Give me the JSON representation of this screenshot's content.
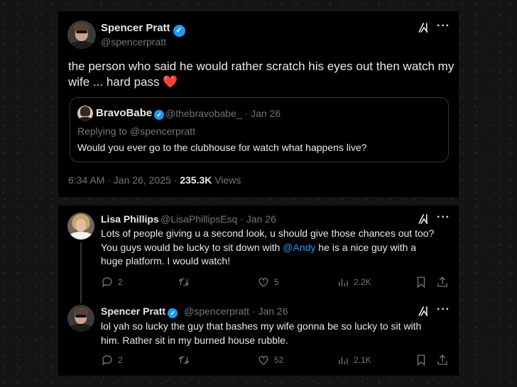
{
  "main_tweet": {
    "name": "Spencer Pratt",
    "handle": "@spencerpratt",
    "text_line1": "the person who said he would rather scratch his eyes out then watch my",
    "text_line2": "wife ... hard pass",
    "heart_glyph": "❤️",
    "timestamp": "6:34 AM · Jan 26, 2025 ·",
    "views_count": "235.3K",
    "views_label": "Views"
  },
  "quoted_tweet": {
    "name": "BravoBabe",
    "handle": "@thebravobabe_ · Jan 26",
    "replying_to": "Replying to @spencerpratt",
    "text": "Would you ever go to the clubhouse for watch what happens live?"
  },
  "reply1": {
    "name": "Lisa Phillips",
    "handle": "@LisaPhillipsEsq · Jan 26",
    "line1": "Lots of people giving u a second look, u should give those chances out too?",
    "line2_pre": "You guys would be lucky to sit down with ",
    "mention": "@Andy",
    "line2_post": " he is a nice guy with a",
    "line3": "huge platform. I would watch!",
    "replies": "2",
    "likes": "5",
    "views": "2.2K"
  },
  "reply2": {
    "name": "Spencer Pratt",
    "handle": "@spencerpratt · Jan 26",
    "line1": "lol yah so lucky the guy that bashes my wife gonna be so lucky to sit with",
    "line2": "him. Rather sit in my burned house rubble.",
    "replies": "2",
    "likes": "52",
    "views": "2.1K"
  },
  "colors": {
    "background": "#000000",
    "text": "#e7e9ea",
    "muted": "#71767b",
    "accent": "#1d9bf0",
    "heart": "#f91880"
  },
  "icons": [
    "verified-badge-icon",
    "grok-icon",
    "more-icon",
    "reply-icon",
    "retweet-icon",
    "like-icon",
    "views-icon",
    "bookmark-icon",
    "share-icon"
  ]
}
